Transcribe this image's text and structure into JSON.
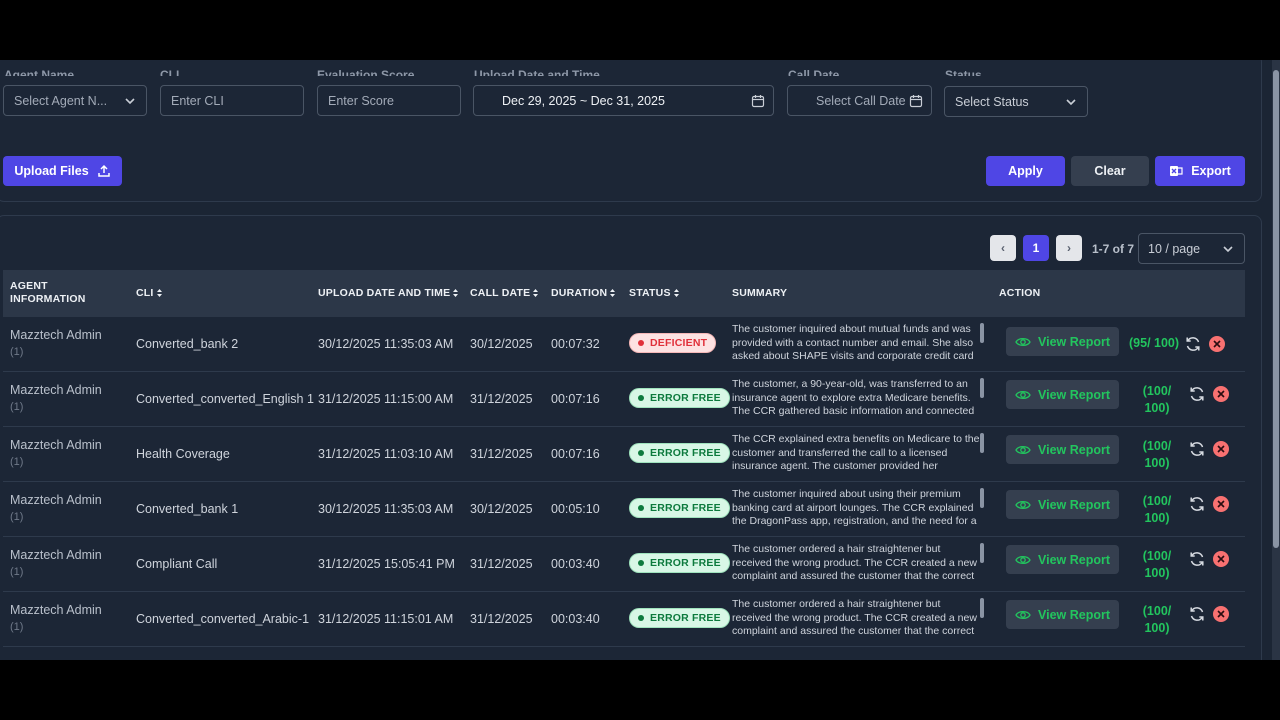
{
  "filters": {
    "agent_name": {
      "label": "Agent Name",
      "placeholder": "Select Agent N..."
    },
    "cli": {
      "label": "CLI",
      "placeholder": "Enter CLI"
    },
    "evaluation_score": {
      "label": "Evaluation Score",
      "placeholder": "Enter Score"
    },
    "upload_date": {
      "label": "Upload Date and Time",
      "value": "Dec 29, 2025 ~ Dec 31, 2025"
    },
    "call_date": {
      "label": "Call Date",
      "placeholder": "Select Call Date"
    },
    "status": {
      "label": "Status",
      "placeholder": "Select Status"
    }
  },
  "toolbar": {
    "upload_label": "Upload Files",
    "apply_label": "Apply",
    "clear_label": "Clear",
    "export_label": "Export"
  },
  "pagination": {
    "current_page": "1",
    "range_info": "1-7 of 7",
    "page_size": "10 / page",
    "prev_symbol": "‹",
    "next_symbol": "›"
  },
  "table": {
    "columns": {
      "agent": "AGENT INFORMATION",
      "cli": "CLI",
      "upload": "UPLOAD DATE AND TIME",
      "call_date": "CALL DATE",
      "duration": "DURATION",
      "status": "STATUS",
      "summary": "SUMMARY",
      "action": "ACTION"
    },
    "view_report_label": "View Report",
    "rows": [
      {
        "agent": "Mazztech Admin",
        "agent_sub": "(1)",
        "cli": "Converted_bank 2",
        "upload": "30/12/2025 11:35:03 AM",
        "call_date": "30/12/2025",
        "duration": "00:07:32",
        "status": "DEFICIENT",
        "summary": "The customer inquired about mutual funds and was provided with a contact number and email. She also asked about SHAPE visits and corporate credit card",
        "score": "(95/ 100)"
      },
      {
        "agent": "Mazztech Admin",
        "agent_sub": "(1)",
        "cli": "Converted_converted_English 1",
        "upload": "31/12/2025 11:15:00 AM",
        "call_date": "31/12/2025",
        "duration": "00:07:16",
        "status": "ERROR FREE",
        "summary": "The customer, a 90-year-old, was transferred to an insurance agent to explore extra Medicare benefits. The CCR gathered basic information and connected",
        "score_line1": "(100/",
        "score_line2": "100)"
      },
      {
        "agent": "Mazztech Admin",
        "agent_sub": "(1)",
        "cli": "Health Coverage",
        "upload": "31/12/2025 11:03:10 AM",
        "call_date": "31/12/2025",
        "duration": "00:07:16",
        "status": "ERROR FREE",
        "summary": "The CCR explained extra benefits on Medicare to the customer and transferred the call to a licensed insurance agent. The customer provided her",
        "score_line1": "(100/",
        "score_line2": "100)"
      },
      {
        "agent": "Mazztech Admin",
        "agent_sub": "(1)",
        "cli": "Converted_bank 1",
        "upload": "30/12/2025 11:35:03 AM",
        "call_date": "30/12/2025",
        "duration": "00:05:10",
        "status": "ERROR FREE",
        "summary": "The customer inquired about using their premium banking card at airport lounges. The CCR explained the DragonPass app, registration, and the need for a",
        "score_line1": "(100/",
        "score_line2": "100)"
      },
      {
        "agent": "Mazztech Admin",
        "agent_sub": "(1)",
        "cli": "Compliant Call",
        "upload": "31/12/2025 15:05:41 PM",
        "call_date": "31/12/2025",
        "duration": "00:03:40",
        "status": "ERROR FREE",
        "summary": "The customer ordered a hair straightener but received the wrong product. The CCR created a new complaint and assured the customer that the correct",
        "score_line1": "(100/",
        "score_line2": "100)"
      },
      {
        "agent": "Mazztech Admin",
        "agent_sub": "(1)",
        "cli": "Converted_converted_Arabic-1",
        "upload": "31/12/2025 11:15:01 AM",
        "call_date": "31/12/2025",
        "duration": "00:03:40",
        "status": "ERROR FREE",
        "summary": "The customer ordered a hair straightener but received the wrong product. The CCR created a new complaint and assured the customer that the correct",
        "score_line1": "(100/",
        "score_line2": "100)"
      }
    ]
  },
  "colors": {
    "accent": "#4f46e5",
    "background": "#1b2534",
    "success": "#22c55e",
    "danger": "#e0303a"
  }
}
